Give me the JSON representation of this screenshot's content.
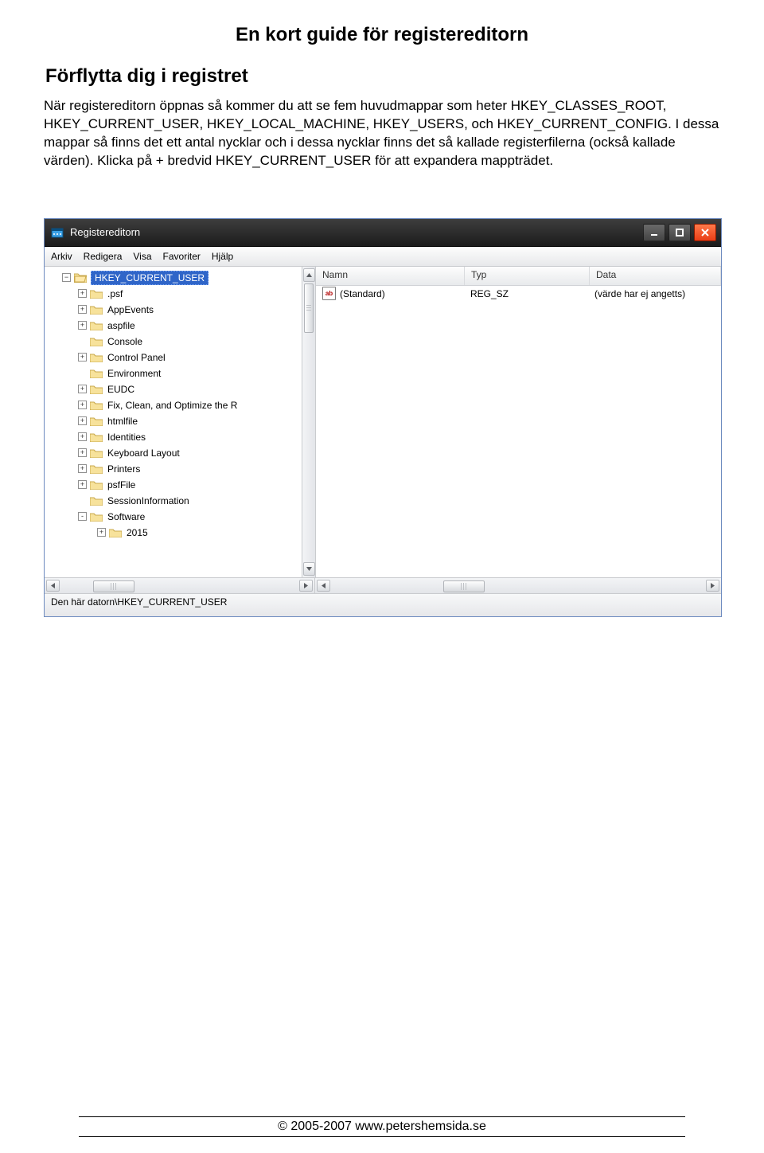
{
  "doc": {
    "title": "En kort guide för registereditorn",
    "section_title": "Förflytta dig i registret",
    "body": "När registereditorn öppnas så kommer du att se fem huvudmappar som heter HKEY_CLASSES_ROOT, HKEY_CURRENT_USER, HKEY_LOCAL_MACHINE, HKEY_USERS, och HKEY_CURRENT_CONFIG. I dessa mappar så finns det ett antal nycklar och i dessa nycklar finns det så kallade registerfilerna (också kallade värden). Klicka på + bredvid HKEY_CURRENT_USER för att expandera mappträdet.",
    "footer": "© 2005-2007 www.petershemsida.se"
  },
  "window": {
    "title": "Registereditorn",
    "menu": [
      "Arkiv",
      "Redigera",
      "Visa",
      "Favoriter",
      "Hjälp"
    ],
    "status": "Den här datorn\\HKEY_CURRENT_USER"
  },
  "tree": {
    "selected": "HKEY_CURRENT_USER",
    "items": [
      {
        "indent": 1,
        "exp": "+",
        "label": ".psf"
      },
      {
        "indent": 1,
        "exp": "+",
        "label": "AppEvents"
      },
      {
        "indent": 1,
        "exp": "+",
        "label": "aspfile"
      },
      {
        "indent": 1,
        "exp": "",
        "label": "Console"
      },
      {
        "indent": 1,
        "exp": "+",
        "label": "Control Panel"
      },
      {
        "indent": 1,
        "exp": "",
        "label": "Environment"
      },
      {
        "indent": 1,
        "exp": "+",
        "label": "EUDC"
      },
      {
        "indent": 1,
        "exp": "+",
        "label": "Fix, Clean, and Optimize the R"
      },
      {
        "indent": 1,
        "exp": "+",
        "label": "htmlfile"
      },
      {
        "indent": 1,
        "exp": "+",
        "label": "Identities"
      },
      {
        "indent": 1,
        "exp": "+",
        "label": "Keyboard Layout"
      },
      {
        "indent": 1,
        "exp": "+",
        "label": "Printers"
      },
      {
        "indent": 1,
        "exp": "+",
        "label": "psfFile"
      },
      {
        "indent": 1,
        "exp": "",
        "label": "SessionInformation"
      },
      {
        "indent": 1,
        "exp": "-",
        "label": "Software"
      },
      {
        "indent": 2,
        "exp": "+",
        "label": "2015"
      }
    ]
  },
  "list": {
    "columns": {
      "name": "Namn",
      "type": "Typ",
      "data": "Data"
    },
    "rows": [
      {
        "name": "(Standard)",
        "type": "REG_SZ",
        "data": "(värde har ej angetts)"
      }
    ]
  }
}
